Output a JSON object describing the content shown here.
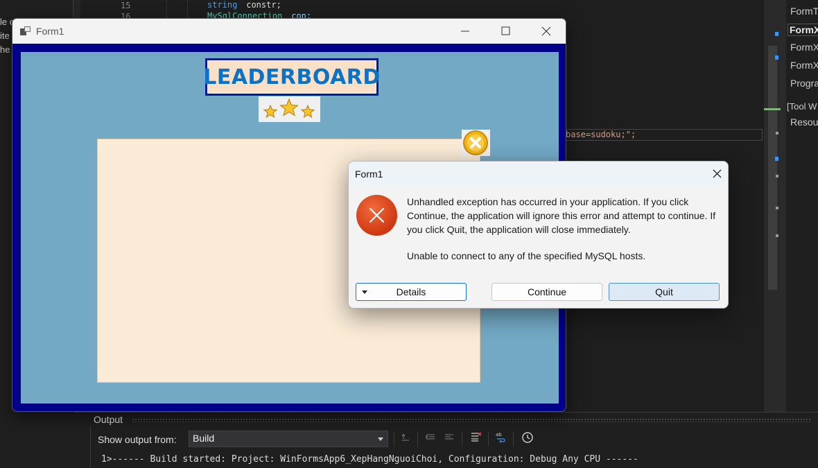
{
  "ide": {
    "left_fragments": [
      "le c",
      "ite",
      "he"
    ],
    "line_numbers": [
      "15",
      "16"
    ],
    "code_line_15": {
      "keyword": "string",
      "rest": " constr;"
    },
    "code_line_16": {
      "type": "MySqlConnection",
      "rest": " con;"
    },
    "code_fragment": "base=sudoku;\";",
    "solution_items": [
      "FormT",
      "FormX",
      "FormX",
      "FormX",
      "Progra",
      "[Tool W",
      "Resou"
    ]
  },
  "output_panel": {
    "title": "Output",
    "show_output_label": "Show output from:",
    "selected_source": "Build",
    "log_line": "1>------ Build started: Project: WinFormsApp6_XepHangNguoiChoi, Configuration: Debug Any CPU ------"
  },
  "form1": {
    "title": "Form1",
    "leaderboard_title": "LEADERBOARD",
    "colors": {
      "frame": "#000088",
      "client": "#73a9c5",
      "board": "#faebd7",
      "title_text": "#0a73c8"
    }
  },
  "dialog": {
    "title": "Form1",
    "message": "Unhandled exception has occurred in your application. If you click Continue, the application will ignore this error and attempt to continue. If you click Quit, the application will close immediately.",
    "detail": "Unable to connect to any of the specified MySQL hosts.",
    "buttons": {
      "details": "Details",
      "continue": "Continue",
      "quit": "Quit"
    },
    "icon": "error-icon"
  }
}
